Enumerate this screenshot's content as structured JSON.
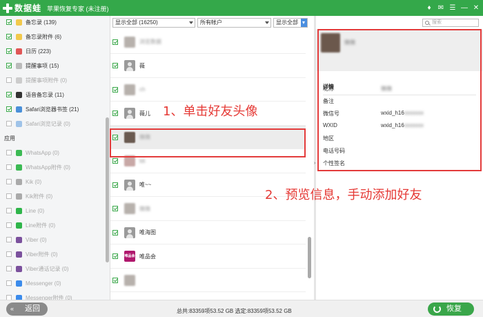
{
  "app": {
    "logo_text": "数据蛙",
    "title": "苹果恢复专家 (未注册)"
  },
  "window_controls": [
    "♦",
    "✉",
    "☰",
    "—",
    "✕"
  ],
  "sidebar": {
    "items": [
      {
        "label": "备忘录 (139)",
        "checked": true,
        "dim": false,
        "icon_color": "#f2c94c"
      },
      {
        "label": "备忘录附件 (6)",
        "checked": true,
        "dim": false,
        "icon_color": "#f2c94c"
      },
      {
        "label": "日历 (223)",
        "checked": true,
        "dim": false,
        "icon_color": "#e05656"
      },
      {
        "label": "提醒事项 (15)",
        "checked": true,
        "dim": false,
        "icon_color": "#bbbbbb"
      },
      {
        "label": "提醒事项附件 (0)",
        "checked": false,
        "dim": true,
        "icon_color": "#cccccc"
      },
      {
        "label": "语音备忘录 (11)",
        "checked": true,
        "dim": false,
        "icon_color": "#333333"
      },
      {
        "label": "Safari浏览器书签 (21)",
        "checked": true,
        "dim": false,
        "icon_color": "#4a90d9"
      },
      {
        "label": "Safari浏览记录 (0)",
        "checked": false,
        "dim": true,
        "icon_color": "#9fc3e8"
      }
    ],
    "section_apps": "应用",
    "app_items": [
      {
        "label": "WhatsApp (0)",
        "icon_color": "#3cba54"
      },
      {
        "label": "WhatsApp附件 (0)",
        "icon_color": "#3cba54"
      },
      {
        "label": "Kik (0)",
        "icon_color": "#aaaaaa"
      },
      {
        "label": "Kik附件 (0)",
        "icon_color": "#aaaaaa"
      },
      {
        "label": "Line (0)",
        "icon_color": "#2fb54a"
      },
      {
        "label": "Line附件 (0)",
        "icon_color": "#2fb54a"
      },
      {
        "label": "Viber (0)",
        "icon_color": "#7b519d"
      },
      {
        "label": "Viber附件 (0)",
        "icon_color": "#7b519d"
      },
      {
        "label": "Viber通话记录 (0)",
        "icon_color": "#7b519d"
      },
      {
        "label": "Messenger (0)",
        "icon_color": "#3b8beb"
      },
      {
        "label": "Messenger附件 (0)",
        "icon_color": "#3b8beb"
      }
    ]
  },
  "filters": {
    "show": "显示全部 (16250)",
    "account": "所有帐户",
    "show2": "显示全部"
  },
  "list": {
    "rows": [
      {
        "name": "浏览数据",
        "checked": true,
        "avatar": "blur",
        "name_blur": true
      },
      {
        "name": "薇",
        "checked": true,
        "avatar": "gray",
        "name_blur": false
      },
      {
        "name": "ch",
        "checked": true,
        "avatar": "blur",
        "name_blur": true
      },
      {
        "name": "薇儿",
        "checked": true,
        "avatar": "gray",
        "name_blur": false
      },
      {
        "name": "微微",
        "checked": true,
        "avatar": "dark",
        "name_blur": true
      },
      {
        "name": "Mi",
        "checked": true,
        "avatar": "pink",
        "name_blur": true
      },
      {
        "name": "唯~~",
        "checked": true,
        "avatar": "gray",
        "name_blur": false
      },
      {
        "name": "微微",
        "checked": true,
        "avatar": "blur",
        "name_blur": true
      },
      {
        "name": "唯海图",
        "checked": true,
        "avatar": "gray",
        "name_blur": false
      },
      {
        "name": "唯品会",
        "checked": true,
        "avatar": "brand",
        "name_blur": false,
        "brand_text": "唯品会"
      },
      {
        "name": "",
        "checked": true,
        "avatar": "blur",
        "name_blur": true
      }
    ]
  },
  "search": {
    "placeholder": "搜索"
  },
  "detail": {
    "name": "微微",
    "section": "详情",
    "fields": [
      {
        "label": "昵称",
        "value": "",
        "blur": "微微"
      },
      {
        "label": "备注",
        "value": "",
        "blur": ""
      },
      {
        "label": "微信号",
        "value": "wxid_h16",
        "blur": "xxxxxxx"
      },
      {
        "label": "WXID",
        "value": "wxid_h16",
        "blur": "xxxxxxx"
      },
      {
        "label": "地区",
        "value": "",
        "blur": ""
      },
      {
        "label": "电话号码",
        "value": "",
        "blur": ""
      },
      {
        "label": "个性签名",
        "value": "",
        "blur": ""
      }
    ]
  },
  "annotations": {
    "step1": "1、单击好友头像",
    "step2": "2、预览信息，手动添加好友"
  },
  "bottom": {
    "back": "返回",
    "status": "总共:83359项53.52 GB 选定:83359项53.52 GB",
    "recover": "恢复"
  }
}
